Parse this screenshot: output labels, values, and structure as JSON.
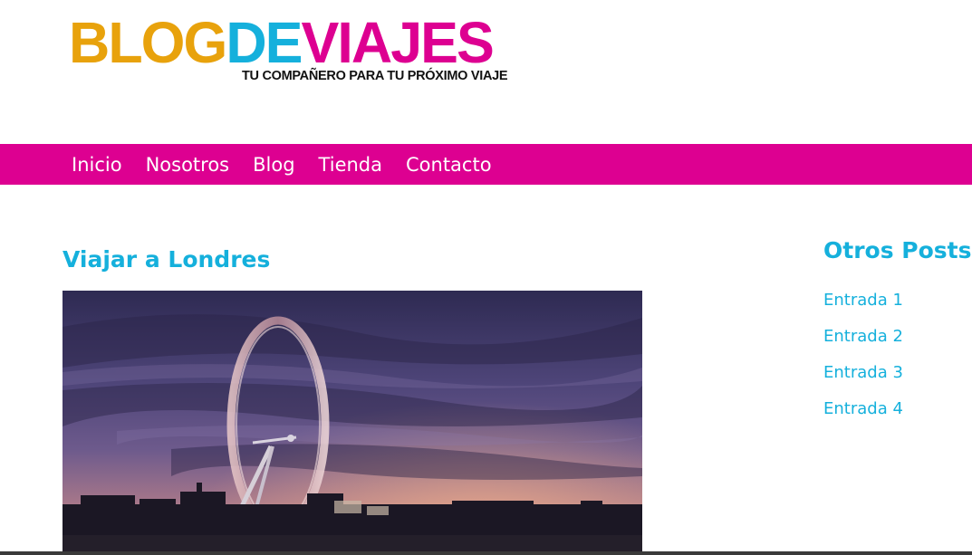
{
  "logo": {
    "parts": [
      "BLOG",
      "DE",
      "VIAJES"
    ],
    "colors": [
      "#e8a20c",
      "#15b0dc",
      "#dd0091"
    ],
    "tagline": "TU COMPAÑERO PARA TU PRÓXIMO VIAJE"
  },
  "nav": {
    "background": "#dd0091",
    "items": [
      {
        "label": "Inicio"
      },
      {
        "label": "Nosotros"
      },
      {
        "label": "Blog"
      },
      {
        "label": "Tienda"
      },
      {
        "label": "Contacto"
      }
    ]
  },
  "post": {
    "title": "Viajar a Londres",
    "image_subject": "london-eye-sunset-photo"
  },
  "sidebar": {
    "title": "Otros Posts",
    "links": [
      {
        "label": "Entrada 1"
      },
      {
        "label": "Entrada 2"
      },
      {
        "label": "Entrada 3"
      },
      {
        "label": "Entrada 4"
      }
    ]
  },
  "theme": {
    "accent": "#15b0dc",
    "brand_pink": "#dd0091",
    "brand_orange": "#e8a20c"
  }
}
